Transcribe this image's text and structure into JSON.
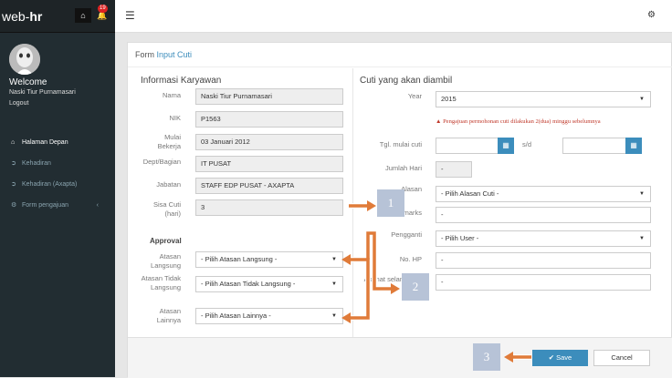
{
  "sidebar": {
    "logo_text": "web-",
    "logo_bold": "hr",
    "notif_count": "19",
    "welcome": "Welcome",
    "user_name": "Naski Tiur Purnamasari",
    "logout": "Logout",
    "menu": [
      {
        "label": "Halaman Depan",
        "icon": "home-icon"
      },
      {
        "label": "Kehadiran",
        "icon": "sign-in-icon"
      },
      {
        "label": "Kehadiran (Axapta)",
        "icon": "sign-in-icon"
      },
      {
        "label": "Form pengajuan",
        "icon": "gear-icon",
        "chevron": "‹"
      }
    ]
  },
  "panel": {
    "title_prefix": "Form ",
    "title_main": "Input Cuti"
  },
  "left": {
    "heading": "Informasi Karyawan",
    "nama_label": "Nama",
    "nama_value": "Naski Tiur Purnamasari",
    "nik_label": "NIK",
    "nik_value": "P1563",
    "mulai_label": "Mulai Bekerja",
    "mulai_value": "03 Januari 2012",
    "dept_label": "Dept/Bagian",
    "dept_value": "IT PUSAT",
    "jabatan_label": "Jabatan",
    "jabatan_value": "STAFF EDP PUSAT - AXAPTA",
    "sisa_label": "Sisa Cuti (hari)",
    "sisa_value": "3",
    "approval": "Approval",
    "atasan_langsung_label": "Atasan Langsung",
    "atasan_langsung_value": "- Pilih Atasan Langsung -",
    "atasan_tidak_label": "Atasan Tidak Langsung",
    "atasan_tidak_value": "- Pilih Atasan Tidak Langsung -",
    "atasan_lain_label": "Atasan Lainnya",
    "atasan_lain_value": "- Pilih Atasan Lainnya -"
  },
  "right": {
    "heading": "Cuti yang akan diambil",
    "year_label": "Year",
    "year_value": "2015",
    "warning": "Pengajuan permohonan cuti dilakukan 2(dua) minggu sebelumnya",
    "tgl_label": "Tgl. mulai cuti",
    "sd_label": "s/d",
    "jumlah_label": "Jumlah Hari",
    "jumlah_value": "-",
    "alasan_label": "Alasan",
    "alasan_value": "- Pilih Alasan Cuti -",
    "remarks_label": "Remarks",
    "remarks_value": "-",
    "pengganti_label": "Pengganti",
    "pengganti_value": "- Pilih User -",
    "nohp_label": "No. HP",
    "nohp_value": "-",
    "alamat_label": "Alamat selama cuti",
    "alamat_value": "-"
  },
  "footer": {
    "save": "Save",
    "cancel": "Cancel"
  },
  "callouts": [
    "1",
    "2",
    "3"
  ],
  "colors": {
    "sidebar_bg": "#222d32",
    "accent": "#3c8dbc",
    "arrow": "#e07b39",
    "callout": "#b7c3d7"
  }
}
